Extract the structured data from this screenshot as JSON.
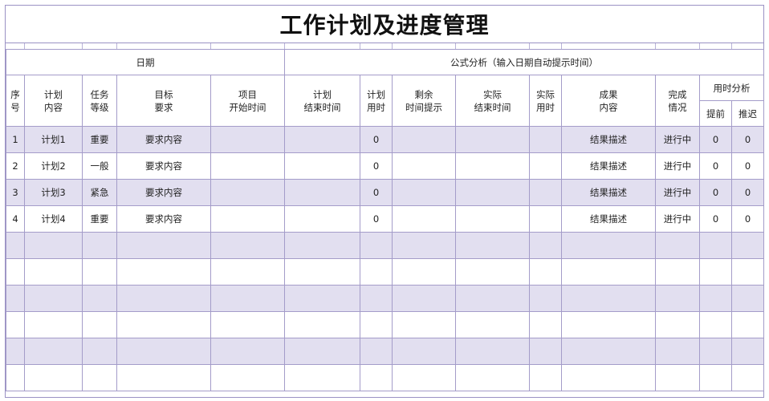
{
  "title": "工作计划及进度管理",
  "groups": {
    "date": "日期",
    "formula": "公式分析（输入日期自动提示时间）",
    "time_analysis": "用时分析"
  },
  "columns": {
    "seq": "序\n号",
    "plan": "计划\n内容",
    "level": "任务\n等级",
    "target": "目标\n要求",
    "start": "项目\n开始时间",
    "plan_end": "计划\n结束时间",
    "plan_days": "计划\n用时",
    "remain": "剩余\n时间提示",
    "actual_end": "实际\n结束时间",
    "actual_days": "实际\n用时",
    "result": "成果\n内容",
    "status": "完成\n情况",
    "ahead": "提前",
    "delay": "推迟"
  },
  "rows": [
    {
      "seq": "1",
      "plan": "计划1",
      "level": "重要",
      "target": "要求内容",
      "start": "",
      "plan_end": "",
      "plan_days": "0",
      "remain": "",
      "actual_end": "",
      "actual_days": "",
      "result": "结果描述",
      "status": "进行中",
      "ahead": "0",
      "delay": "0"
    },
    {
      "seq": "2",
      "plan": "计划2",
      "level": "一般",
      "target": "要求内容",
      "start": "",
      "plan_end": "",
      "plan_days": "0",
      "remain": "",
      "actual_end": "",
      "actual_days": "",
      "result": "结果描述",
      "status": "进行中",
      "ahead": "0",
      "delay": "0"
    },
    {
      "seq": "3",
      "plan": "计划3",
      "level": "紧急",
      "target": "要求内容",
      "start": "",
      "plan_end": "",
      "plan_days": "0",
      "remain": "",
      "actual_end": "",
      "actual_days": "",
      "result": "结果描述",
      "status": "进行中",
      "ahead": "0",
      "delay": "0"
    },
    {
      "seq": "4",
      "plan": "计划4",
      "level": "重要",
      "target": "要求内容",
      "start": "",
      "plan_end": "",
      "plan_days": "0",
      "remain": "",
      "actual_end": "",
      "actual_days": "",
      "result": "结果描述",
      "status": "进行中",
      "ahead": "0",
      "delay": "0"
    }
  ],
  "empty_rows": 6,
  "colors": {
    "shade": "#e2dff0",
    "border": "#a49cc9"
  }
}
